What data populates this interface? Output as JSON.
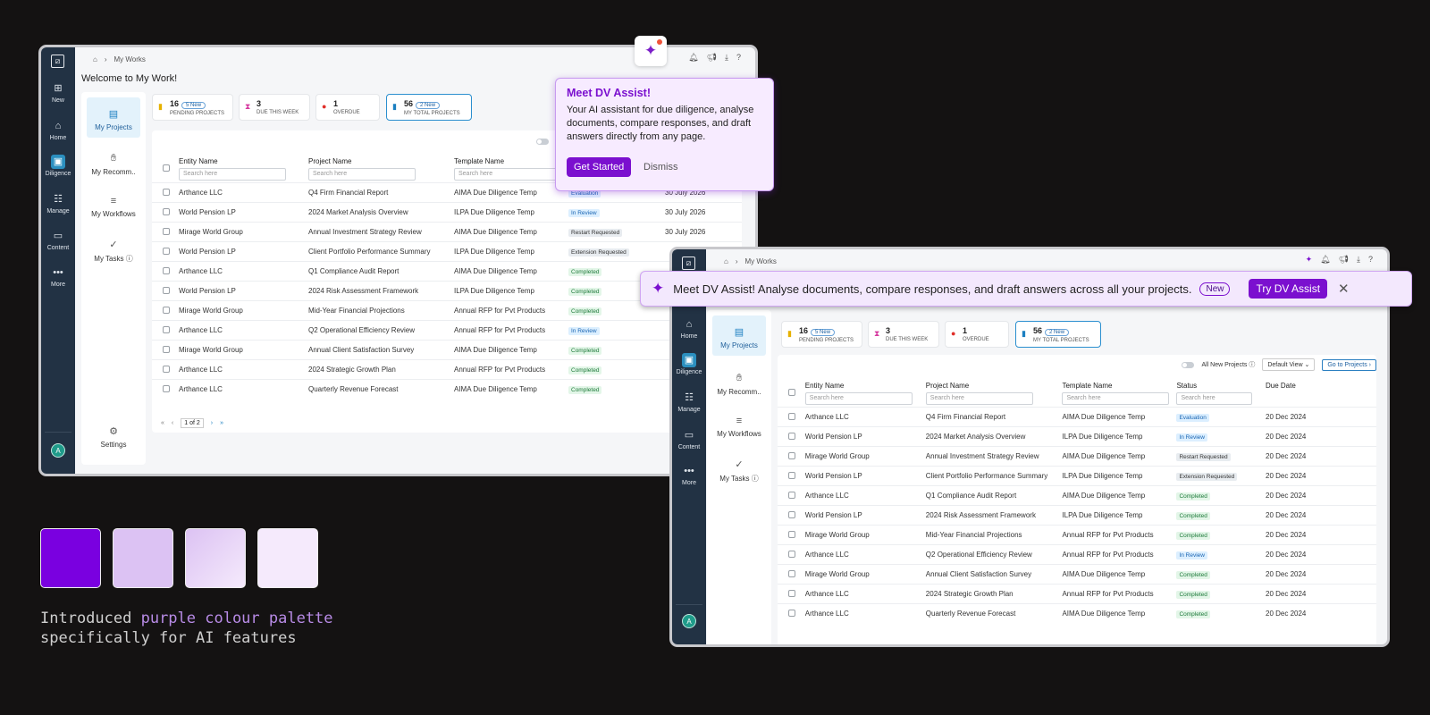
{
  "window1": {
    "breadcrumb": "My Works",
    "welcome": "Welcome to My Work!",
    "rail": [
      "New",
      "Home",
      "Diligence",
      "Manage",
      "Content",
      "More"
    ],
    "avatar": "A",
    "subnav": [
      "My Projects",
      "My Recomm..",
      "My Workflows",
      "My Tasks ⓘ",
      "Settings"
    ],
    "stats": [
      {
        "num": "16",
        "badge": "5 New",
        "label": "Pending Projects"
      },
      {
        "num": "3",
        "badge": "",
        "label": "Due this week"
      },
      {
        "num": "1",
        "badge": "",
        "label": "Overdue"
      },
      {
        "num": "56",
        "badge": "2 New",
        "label": "My Total Projects"
      }
    ],
    "columns": [
      "Entity Name",
      "Project Name",
      "Template Name"
    ],
    "search_placeholder": "Search here",
    "rows": [
      [
        "Arthance LLC",
        "Q4 Firm Financial Report",
        "AIMA Due Diligence Temp",
        "Evaluation",
        "30 July 2026"
      ],
      [
        "World Pension LP",
        "2024 Market Analysis Overview",
        "ILPA Due Diligence Temp",
        "In Review",
        "30 July 2026"
      ],
      [
        "Mirage World Group",
        "Annual Investment Strategy Review",
        "AIMA Due Diligence Temp",
        "Restart Requested",
        "30 July 2026"
      ],
      [
        "World Pension LP",
        "Client Portfolio Performance Summary",
        "ILPA Due Diligence Temp",
        "Extension Requested",
        ""
      ],
      [
        "Arthance LLC",
        "Q1 Compliance Audit Report",
        "AIMA Due Diligence Temp",
        "Completed",
        ""
      ],
      [
        "World Pension LP",
        "2024 Risk Assessment Framework",
        "ILPA Due Diligence Temp",
        "Completed",
        ""
      ],
      [
        "Mirage World Group",
        "Mid-Year Financial Projections",
        "Annual RFP for Pvt Products",
        "Completed",
        ""
      ],
      [
        "Arthance LLC",
        "Q2 Operational Efficiency Review",
        "Annual RFP for Pvt Products",
        "In Review",
        ""
      ],
      [
        "Mirage World Group",
        "Annual Client Satisfaction Survey",
        "AIMA Due Diligence Temp",
        "Completed",
        ""
      ],
      [
        "Arthance LLC",
        "2024 Strategic Growth Plan",
        "Annual RFP for Pvt Products",
        "Completed",
        ""
      ],
      [
        "Arthance LLC",
        "Quarterly Revenue Forecast",
        "AIMA Due Diligence Temp",
        "Completed",
        ""
      ]
    ],
    "pager": "1 of 2"
  },
  "popup": {
    "title": "Meet DV Assist!",
    "body": "Your AI assistant for due diligence, analyse documents, compare responses, and draft answers directly from any page.",
    "primary": "Get Started",
    "secondary": "Dismiss"
  },
  "window2": {
    "breadcrumb": "My Works",
    "rail": [
      "Home",
      "Diligence",
      "Manage",
      "Content",
      "More"
    ],
    "avatar": "A",
    "subnav": [
      "My Projects",
      "My Recomm..",
      "My Workflows",
      "My Tasks ⓘ"
    ],
    "stats": [
      {
        "num": "16",
        "badge": "5 New",
        "label": "Pending Projects"
      },
      {
        "num": "3",
        "badge": "",
        "label": "Due this week"
      },
      {
        "num": "1",
        "badge": "",
        "label": "Overdue"
      },
      {
        "num": "56",
        "badge": "2 New",
        "label": "My Total Projects"
      }
    ],
    "tools": {
      "toggle_label": "All New Projects ⓘ",
      "view": "Default View",
      "go": "Go to Projects"
    },
    "columns": [
      "Entity Name",
      "Project Name",
      "Template Name",
      "Status",
      "Due Date"
    ],
    "search_placeholder": "Search here",
    "rows": [
      [
        "Arthance LLC",
        "Q4 Firm Financial Report",
        "AIMA Due Diligence Temp",
        "Evaluation",
        "20 Dec 2024"
      ],
      [
        "World Pension LP",
        "2024 Market Analysis Overview",
        "ILPA Due Diligence Temp",
        "In Review",
        "20 Dec 2024"
      ],
      [
        "Mirage World Group",
        "Annual Investment Strategy Review",
        "AIMA Due Diligence Temp",
        "Restart Requested",
        "20 Dec 2024"
      ],
      [
        "World Pension LP",
        "Client Portfolio Performance Summary",
        "ILPA Due Diligence Temp",
        "Extension Requested",
        "20 Dec 2024"
      ],
      [
        "Arthance LLC",
        "Q1 Compliance Audit Report",
        "AIMA Due Diligence Temp",
        "Completed",
        "20 Dec 2024"
      ],
      [
        "World Pension LP",
        "2024 Risk Assessment Framework",
        "ILPA Due Diligence Temp",
        "Completed",
        "20 Dec 2024"
      ],
      [
        "Mirage World Group",
        "Mid-Year Financial Projections",
        "Annual RFP for Pvt Products",
        "Completed",
        "20 Dec 2024"
      ],
      [
        "Arthance LLC",
        "Q2 Operational Efficiency Review",
        "Annual RFP for Pvt Products",
        "In Review",
        "20 Dec 2024"
      ],
      [
        "Mirage World Group",
        "Annual Client Satisfaction Survey",
        "AIMA Due Diligence Temp",
        "Completed",
        "20 Dec 2024"
      ],
      [
        "Arthance LLC",
        "2024 Strategic Growth Plan",
        "Annual RFP for Pvt Products",
        "Completed",
        "20 Dec 2024"
      ],
      [
        "Arthance LLC",
        "Quarterly Revenue Forecast",
        "AIMA Due Diligence Temp",
        "Completed",
        "20 Dec 2024"
      ]
    ]
  },
  "banner": {
    "text": "Meet DV Assist! Analyse documents, compare responses, and draft answers across all your projects.",
    "badge": "New",
    "button": "Try DV Assist"
  },
  "palette": [
    "#7a00e0",
    "#dcc2f3",
    "#d5b9ef",
    "#f5eafc"
  ],
  "caption": {
    "line1_a": "Introduced ",
    "line1_b": "purple colour palette",
    "line2": "specifically for AI features"
  }
}
